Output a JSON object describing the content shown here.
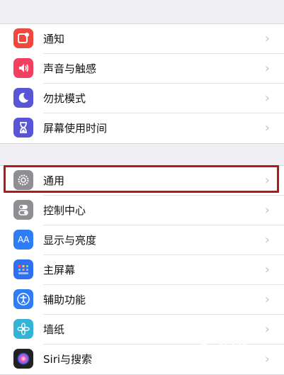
{
  "groups": [
    {
      "items": [
        {
          "label": "通知",
          "icon": "notifications-icon",
          "color": "#f2473d"
        },
        {
          "label": "声音与触感",
          "icon": "sound-icon",
          "color": "#f43f5e"
        },
        {
          "label": "勿扰模式",
          "icon": "moon-icon",
          "color": "#5856d6"
        },
        {
          "label": "屏幕使用时间",
          "icon": "hourglass-icon",
          "color": "#5856d6"
        }
      ]
    },
    {
      "items": [
        {
          "label": "通用",
          "icon": "gear-icon",
          "color": "#8e8e93"
        },
        {
          "label": "控制中心",
          "icon": "toggles-icon",
          "color": "#8e8e93"
        },
        {
          "label": "显示与亮度",
          "icon": "aa-icon",
          "icon_text": "AA",
          "color": "#2f7df6"
        },
        {
          "label": "主屏幕",
          "icon": "home-screen-icon",
          "color": "#2f6ff2"
        },
        {
          "label": "辅助功能",
          "icon": "accessibility-icon",
          "color": "#2f7df6"
        },
        {
          "label": "墙纸",
          "icon": "flower-icon",
          "color": "#33b3d6"
        },
        {
          "label": "Siri与搜索",
          "icon": "siri-icon",
          "color": "#222222"
        }
      ]
    }
  ],
  "chevron": "›",
  "highlight_color": "#b3191c",
  "watermark": {
    "text": "Bai经验",
    "sub": "jingyan.baidu.com"
  }
}
